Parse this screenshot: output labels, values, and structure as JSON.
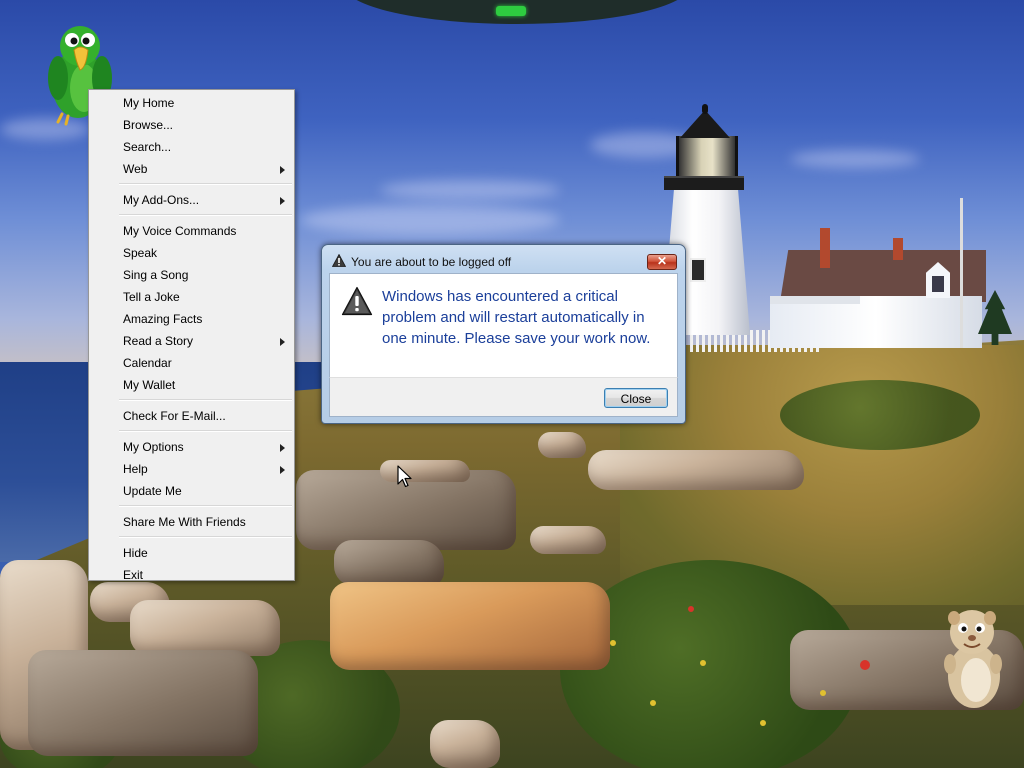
{
  "context_menu": {
    "items": [
      {
        "label": "My Home"
      },
      {
        "label": "Browse..."
      },
      {
        "label": "Search..."
      },
      {
        "label": "Web"
      },
      {
        "label": "My Add-Ons..."
      },
      {
        "label": "My Voice Commands"
      },
      {
        "label": "Speak"
      },
      {
        "label": "Sing a Song"
      },
      {
        "label": "Tell a Joke"
      },
      {
        "label": "Amazing Facts"
      },
      {
        "label": "Read a Story"
      },
      {
        "label": "Calendar"
      },
      {
        "label": "My Wallet"
      },
      {
        "label": "Check For E-Mail..."
      },
      {
        "label": "My Options"
      },
      {
        "label": "Help"
      },
      {
        "label": "Update Me"
      },
      {
        "label": "Share Me With Friends"
      },
      {
        "label": "Hide"
      },
      {
        "label": "Exit"
      }
    ]
  },
  "dialog": {
    "title": "You are about to be logged off",
    "close_glyph": "✕",
    "message": "Windows has encountered a critical problem and will restart automatically in one minute. Please save your work now.",
    "button_label": "Close",
    "icon": "warning-icon"
  },
  "icons": {
    "desktop_assistant": "parrot-icon",
    "desktop_companion": "hamster-icon",
    "submenu": "chevron-right-icon"
  },
  "colors": {
    "dialog_message": "#1b3f9a",
    "close_button": "#c8412a",
    "status_led": "#2ecc40"
  }
}
